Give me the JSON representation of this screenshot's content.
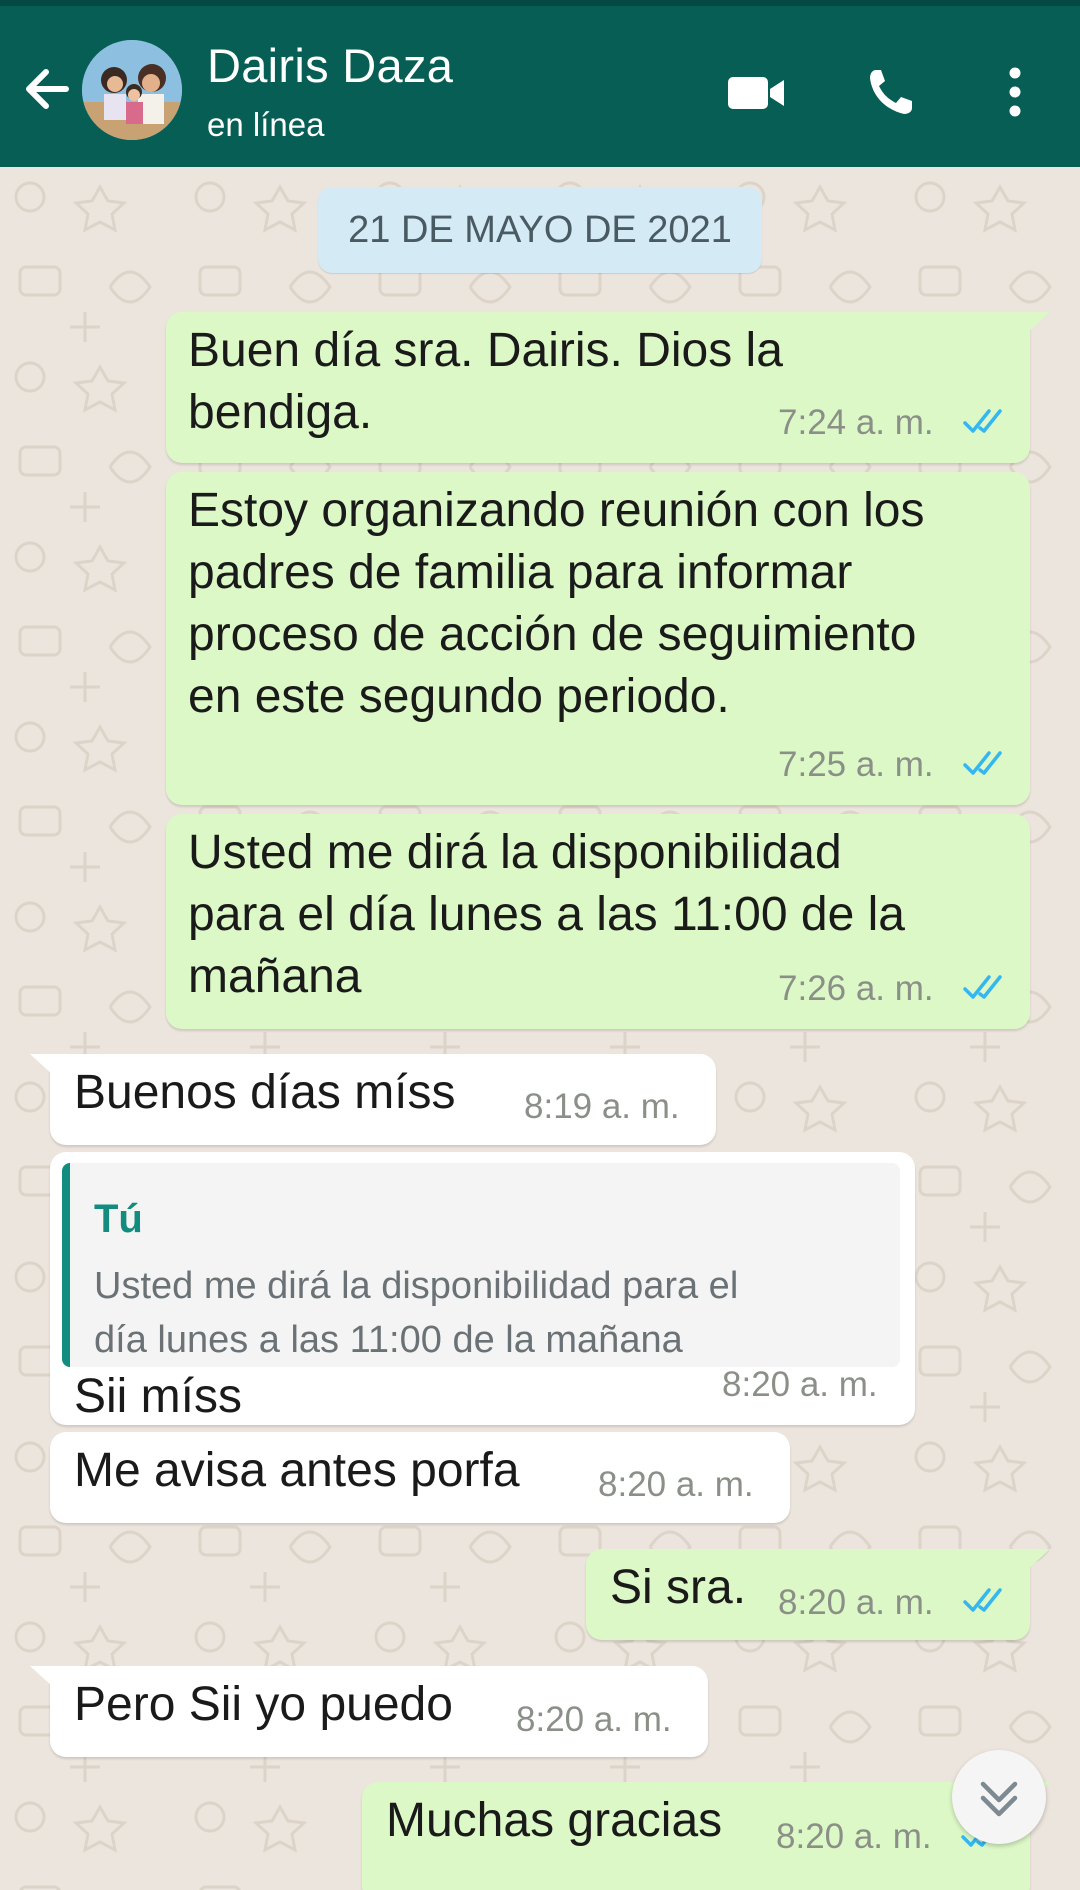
{
  "header": {
    "contact_name": "Dairis Daza",
    "status": "en línea",
    "colors": {
      "bar": "#075e54"
    },
    "icons": [
      "arrow-left-icon",
      "video-camera-icon",
      "phone-icon",
      "more-vert-icon"
    ]
  },
  "chat": {
    "date": "21 DE MAYO DE 2021",
    "messages": [
      {
        "dir": "out",
        "lines": [
          "Buen día sra. Dairis. Dios la",
          "bendiga."
        ],
        "time": "7:24 a. m.",
        "status": "read"
      },
      {
        "dir": "out",
        "lines": [
          "Estoy organizando reunión con los",
          "padres de familia para informar",
          "proceso de acción de seguimiento",
          "en este segundo periodo."
        ],
        "time": "7:25 a. m.",
        "status": "read"
      },
      {
        "dir": "out",
        "lines": [
          "Usted me dirá la disponibilidad",
          "para el día lunes a las 11:00 de la",
          "mañana"
        ],
        "time": "7:26 a. m.",
        "status": "read"
      },
      {
        "dir": "in",
        "lines": [
          "Buenos días míss"
        ],
        "time": "8:19 a. m."
      },
      {
        "dir": "in",
        "quote": {
          "author": "Tú",
          "lines": [
            "Usted me dirá la disponibilidad para el",
            "día lunes a las 11:00 de la mañana"
          ]
        },
        "lines": [
          "Sii míss"
        ],
        "time": "8:20 a. m."
      },
      {
        "dir": "in",
        "lines": [
          "Me avisa antes porfa"
        ],
        "time": "8:20 a. m."
      },
      {
        "dir": "out",
        "lines": [
          "Si sra."
        ],
        "time": "8:20 a. m.",
        "status": "read"
      },
      {
        "dir": "in",
        "lines": [
          "Pero Sii yo puedo"
        ],
        "time": "8:20 a. m."
      },
      {
        "dir": "out",
        "lines": [
          "Muchas gracias"
        ],
        "time": "8:20 a. m.",
        "status": "read"
      }
    ]
  },
  "colors": {
    "outgoing_bubble": "#dcf8c6",
    "incoming_bubble": "#ffffff",
    "read_ticks": "#34b7f1",
    "chat_background": "#ece5dd",
    "quote_accent": "#128c7e"
  }
}
